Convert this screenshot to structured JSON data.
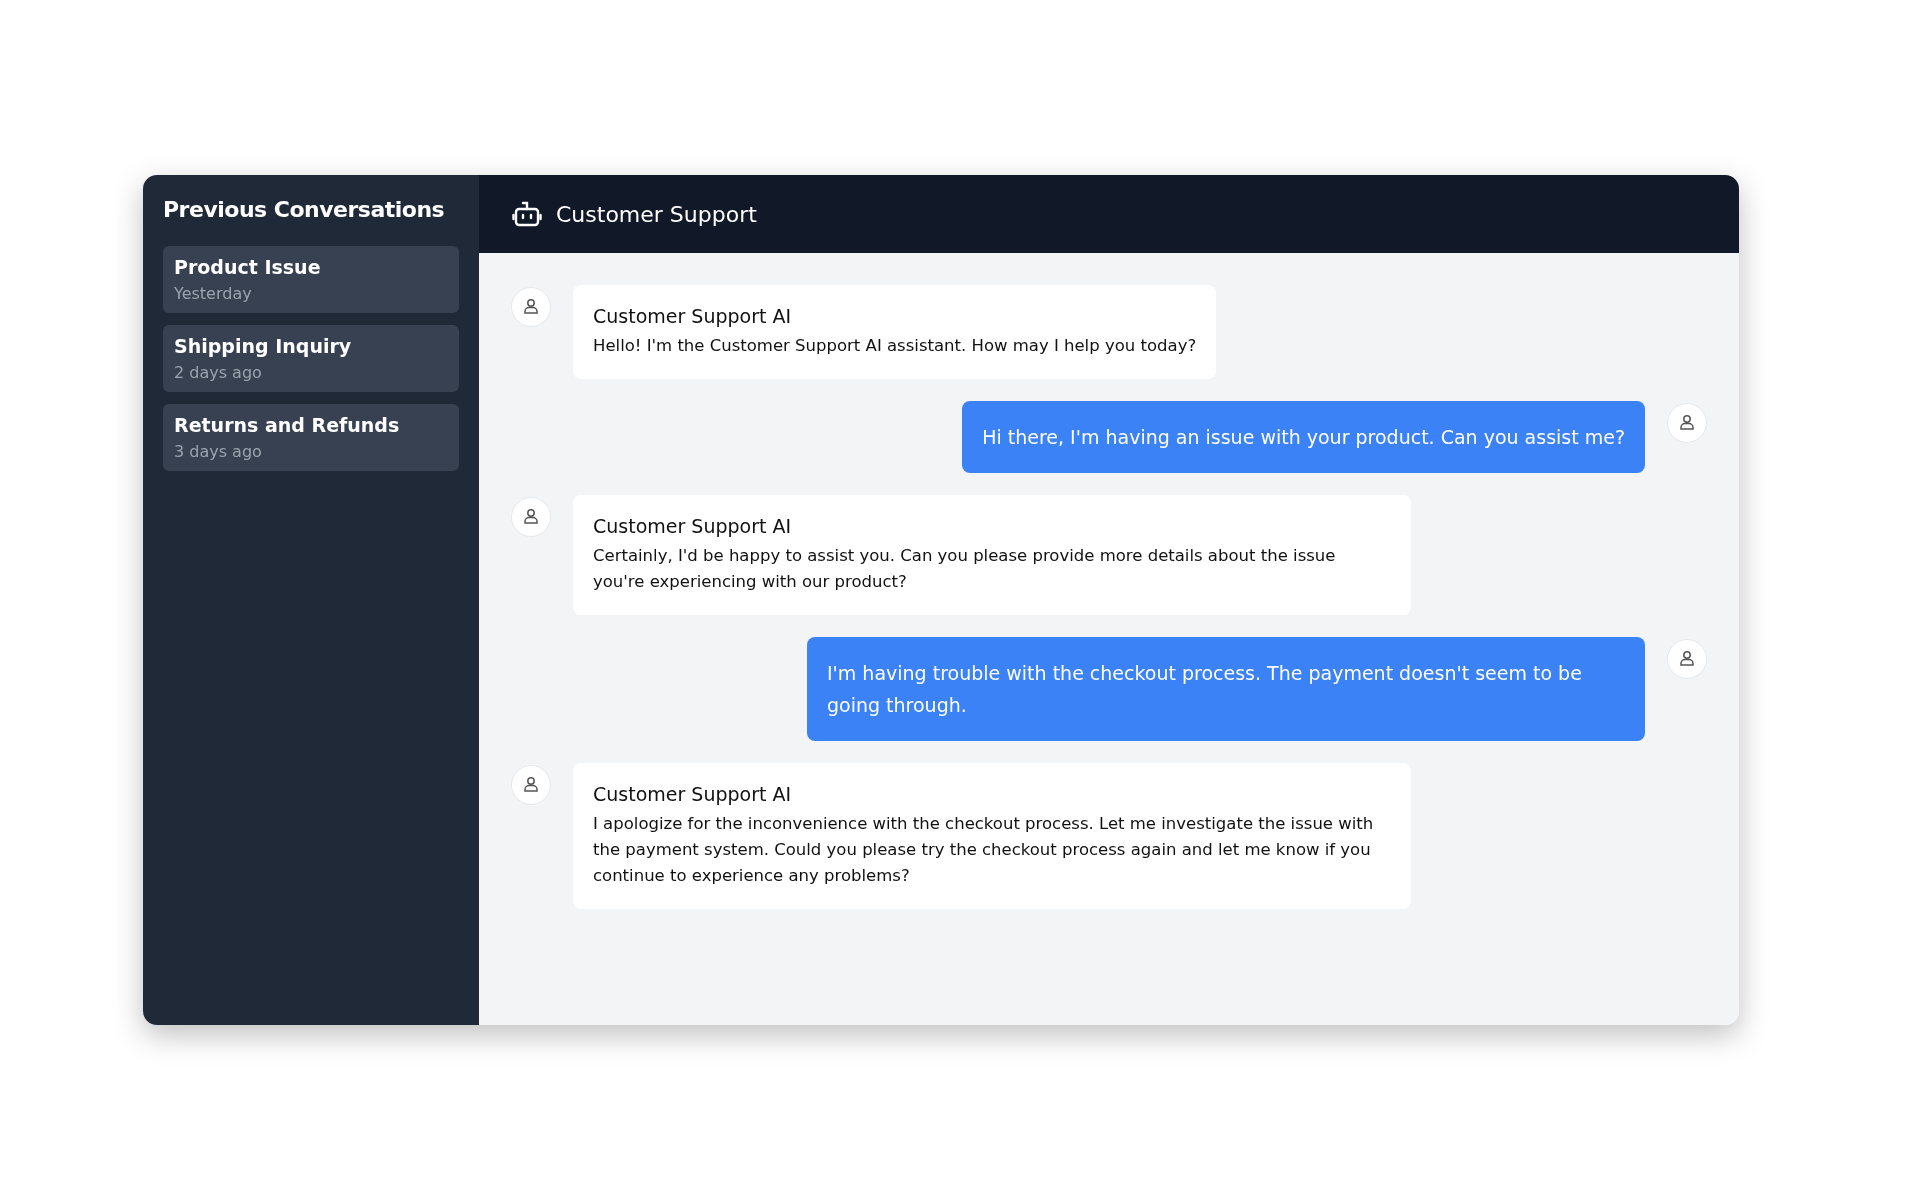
{
  "sidebar": {
    "title": "Previous Conversations",
    "items": [
      {
        "title": "Product Issue",
        "time": "Yesterday"
      },
      {
        "title": "Shipping Inquiry",
        "time": "2 days ago"
      },
      {
        "title": "Returns and Refunds",
        "time": "3 days ago"
      }
    ]
  },
  "header": {
    "title": "Customer Support"
  },
  "messages": [
    {
      "kind": "bot",
      "sender": "Customer Support AI",
      "text": "Hello! I'm the Customer Support AI assistant. How may I help you today?"
    },
    {
      "kind": "user",
      "text": "Hi there, I'm having an issue with your product. Can you assist me?"
    },
    {
      "kind": "bot",
      "sender": "Customer Support AI",
      "text": "Certainly, I'd be happy to assist you. Can you please provide more details about the issue you're experiencing with our product?"
    },
    {
      "kind": "user",
      "text": "I'm having trouble with the checkout process. The payment doesn't seem to be going through."
    },
    {
      "kind": "bot",
      "sender": "Customer Support AI",
      "text": "I apologize for the inconvenience with the checkout process. Let me investigate the issue with the payment system. Could you please try the checkout process again and let me know if you continue to experience any problems?"
    }
  ]
}
